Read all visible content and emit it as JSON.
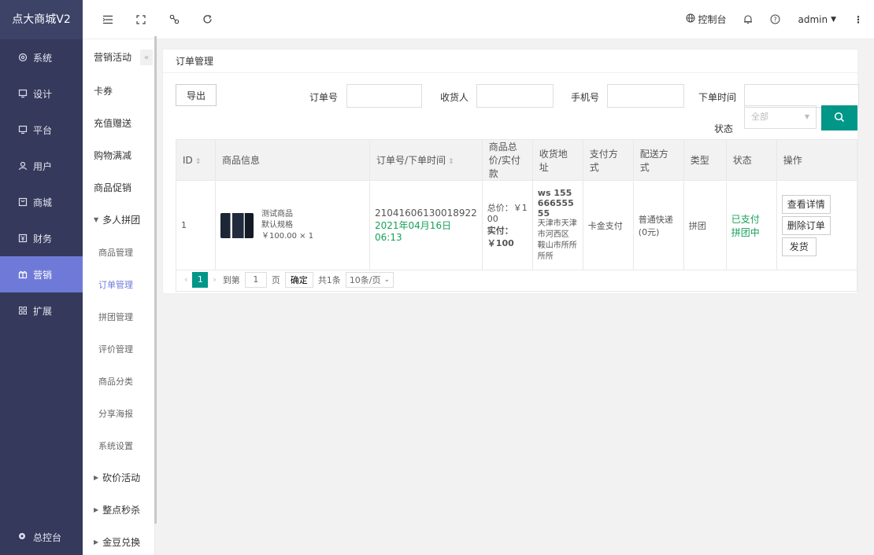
{
  "sidebar": {
    "logo": "点大商城V2",
    "items": [
      {
        "label": "系统",
        "icon": "gear-icon"
      },
      {
        "label": "设计",
        "icon": "monitor-icon"
      },
      {
        "label": "平台",
        "icon": "monitor-icon"
      },
      {
        "label": "用户",
        "icon": "user-icon"
      },
      {
        "label": "商城",
        "icon": "shop-icon"
      },
      {
        "label": "财务",
        "icon": "finance-icon"
      },
      {
        "label": "营销",
        "icon": "gift-icon"
      },
      {
        "label": "扩展",
        "icon": "grid-icon"
      }
    ],
    "active_index": 6,
    "bottom": "总控台"
  },
  "submenu": {
    "header": "营销活动",
    "items": [
      {
        "label": "卡券"
      },
      {
        "label": "充值赠送"
      },
      {
        "label": "购物满减"
      },
      {
        "label": "商品促销"
      },
      {
        "label": "多人拼团",
        "expanded": true
      },
      {
        "label": "商品管理",
        "child": true
      },
      {
        "label": "订单管理",
        "child": true,
        "active": true
      },
      {
        "label": "拼团管理",
        "child": true
      },
      {
        "label": "评价管理",
        "child": true
      },
      {
        "label": "商品分类",
        "child": true
      },
      {
        "label": "分享海报",
        "child": true
      },
      {
        "label": "系统设置",
        "child": true
      },
      {
        "label": "砍价活动"
      },
      {
        "label": "整点秒杀"
      },
      {
        "label": "金豆兑换"
      }
    ]
  },
  "topbar": {
    "console": "控制台",
    "user": "admin"
  },
  "page": {
    "title": "订单管理",
    "export_label": "导出",
    "filters": {
      "order_no": "订单号",
      "receiver": "收货人",
      "phone": "手机号",
      "order_time": "下单时间",
      "status": "状态",
      "status_value": "全部"
    }
  },
  "table": {
    "headers": [
      "ID",
      "商品信息",
      "订单号/下单时间",
      "商品总价/实付款",
      "收货地址",
      "支付方式",
      "配送方式",
      "类型",
      "状态",
      "操作"
    ],
    "rows": [
      {
        "id": "1",
        "goods_name": "测试商品",
        "goods_spec": "默认规格",
        "goods_price": "￥100.00 × 1",
        "order_no": "21041606130018922",
        "order_time": "2021年04月16日 06:13",
        "total": "总价：￥100",
        "paid": "实付：￥100",
        "addr_name": "ws 15566655555",
        "addr_detail": "天津市天津市河西区 鞍山市所所所所",
        "pay_method": "卡金支付",
        "delivery": "普通快递(0元)",
        "type": "拼团",
        "status1": "已支付",
        "status2": "拼团中",
        "ops": [
          "查看详情",
          "删除订单",
          "发货"
        ]
      }
    ]
  },
  "pager": {
    "current": "1",
    "goto": "到第",
    "page_input": "1",
    "page_unit": "页",
    "confirm": "确定",
    "total": "共1条",
    "size": "10条/页"
  },
  "colors": {
    "sidebar_bg": "#353a5c",
    "active": "#6f7ad8",
    "primary": "#009688",
    "paid": "#18a058"
  }
}
